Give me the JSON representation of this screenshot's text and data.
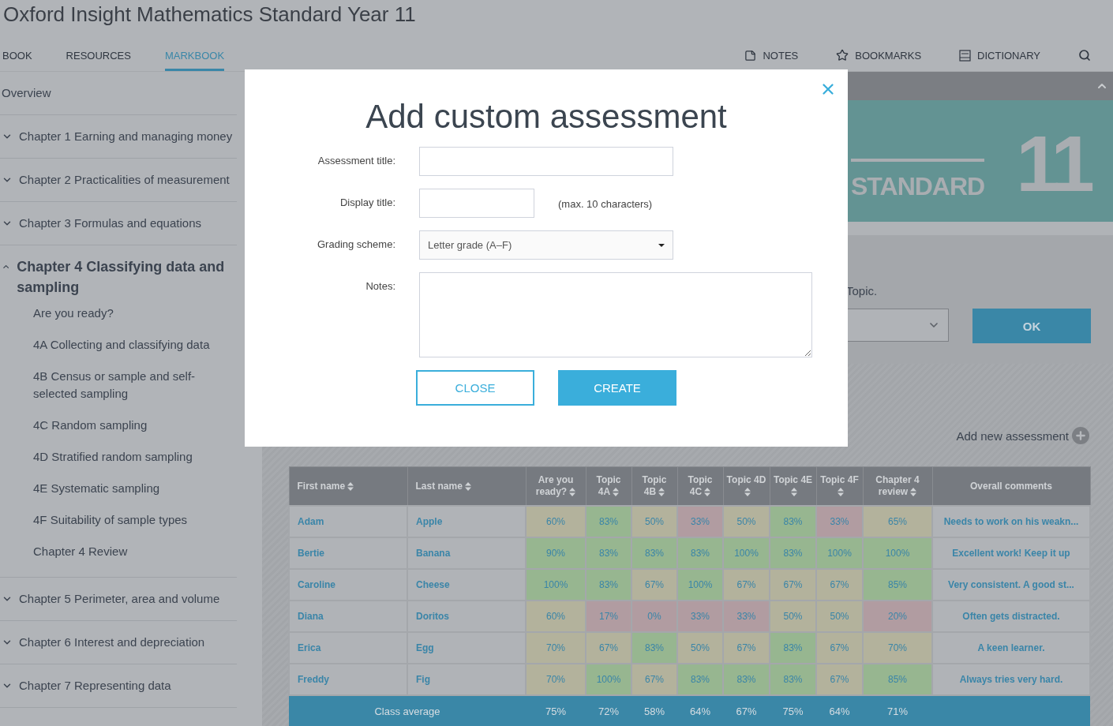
{
  "header": {
    "title": "Oxford Insight Mathematics Standard Year 11"
  },
  "nav": {
    "tabs": [
      {
        "label": "BOOK",
        "selected": false
      },
      {
        "label": "RESOURCES",
        "selected": false
      },
      {
        "label": "MARKBOOK",
        "selected": true
      }
    ],
    "tools": [
      {
        "kind": "notes",
        "label": "NOTES"
      },
      {
        "kind": "bookmarks",
        "label": "BOOKMARKS"
      },
      {
        "kind": "dictionary",
        "label": "DICTIONARY"
      },
      {
        "kind": "search"
      }
    ]
  },
  "sidebar": {
    "items": [
      {
        "kind": "plain",
        "label": "Overview"
      },
      {
        "kind": "chapter",
        "label": "Chapter 1 Earning and managing money",
        "expanded": false
      },
      {
        "kind": "chapter",
        "label": "Chapter 2 Practicalities of measurement",
        "expanded": false
      },
      {
        "kind": "chapter",
        "label": "Chapter 3 Formulas and equations",
        "expanded": false
      },
      {
        "kind": "chapter",
        "label": "Chapter 4 Classifying data and sampling",
        "expanded": true,
        "children": [
          {
            "label": "Are you ready?"
          },
          {
            "label": "4A Collecting and classifying data"
          },
          {
            "label": "4B Census or sample and self-selected sampling"
          },
          {
            "label": "4C Random sampling"
          },
          {
            "label": "4D Stratified random sampling"
          },
          {
            "label": "4E Systematic sampling"
          },
          {
            "label": "4F Suitability of sample types"
          },
          {
            "label": "Chapter 4 Review"
          }
        ]
      },
      {
        "kind": "chapter",
        "label": "Chapter 5 Perimeter, area and volume",
        "expanded": false
      },
      {
        "kind": "chapter",
        "label": "Chapter 6 Interest and depreciation",
        "expanded": false
      },
      {
        "kind": "chapter",
        "label": "Chapter 7 Representing data",
        "expanded": false
      }
    ]
  },
  "main": {
    "banner": {
      "word": "STANDARD",
      "number": "11"
    },
    "intro": {
      "text": "Topic."
    },
    "ok_button": "OK",
    "add_assessment": "Add new assessment",
    "table": {
      "columns": [
        {
          "label": "First name",
          "sortable": true
        },
        {
          "label": "Last name",
          "sortable": true
        },
        {
          "label": "Are you ready?",
          "sortable": true
        },
        {
          "label": "Topic 4A",
          "sortable": true
        },
        {
          "label": "Topic 4B",
          "sortable": true
        },
        {
          "label": "Topic 4C",
          "sortable": true
        },
        {
          "label": "Topic 4D",
          "sortable": true
        },
        {
          "label": "Topic 4E",
          "sortable": true
        },
        {
          "label": "Topic 4F",
          "sortable": true
        },
        {
          "label": "Chapter 4 review",
          "sortable": true
        },
        {
          "label": "Overall comments",
          "sortable": false
        }
      ],
      "rows": [
        {
          "first": "Adam",
          "last": "Apple",
          "scores": [
            {
              "value": "60%",
              "color": "#b3b29c"
            },
            {
              "value": "83%",
              "color": "#97b690"
            },
            {
              "value": "50%",
              "color": "#b3b29c"
            },
            {
              "value": "33%",
              "color": "#b19ca1"
            },
            {
              "value": "50%",
              "color": "#b3b29c"
            },
            {
              "value": "83%",
              "color": "#97b690"
            },
            {
              "value": "33%",
              "color": "#b19ca1"
            },
            {
              "value": "65%",
              "color": "#b3b29c"
            }
          ],
          "comment": "Needs to work on his weakn..."
        },
        {
          "first": "Bertie",
          "last": "Banana",
          "scores": [
            {
              "value": "90%",
              "color": "#97b690"
            },
            {
              "value": "83%",
              "color": "#97b690"
            },
            {
              "value": "83%",
              "color": "#97b690"
            },
            {
              "value": "83%",
              "color": "#97b690"
            },
            {
              "value": "100%",
              "color": "#97b690"
            },
            {
              "value": "83%",
              "color": "#97b690"
            },
            {
              "value": "100%",
              "color": "#97b690"
            },
            {
              "value": "100%",
              "color": "#97b690"
            }
          ],
          "comment": "Excellent work! Keep it up"
        },
        {
          "first": "Caroline",
          "last": "Cheese",
          "scores": [
            {
              "value": "100%",
              "color": "#97b690"
            },
            {
              "value": "83%",
              "color": "#97b690"
            },
            {
              "value": "67%",
              "color": "#b3b29c"
            },
            {
              "value": "100%",
              "color": "#97b690"
            },
            {
              "value": "67%",
              "color": "#b3b29c"
            },
            {
              "value": "67%",
              "color": "#b3b29c"
            },
            {
              "value": "67%",
              "color": "#b3b29c"
            },
            {
              "value": "85%",
              "color": "#97b690"
            }
          ],
          "comment": "Very consistent. A good st..."
        },
        {
          "first": "Diana",
          "last": "Doritos",
          "scores": [
            {
              "value": "60%",
              "color": "#b3b29c"
            },
            {
              "value": "17%",
              "color": "#b19ca1"
            },
            {
              "value": "0%",
              "color": "#b19ca1"
            },
            {
              "value": "33%",
              "color": "#b19ca1"
            },
            {
              "value": "33%",
              "color": "#b19ca1"
            },
            {
              "value": "50%",
              "color": "#b3b29c"
            },
            {
              "value": "50%",
              "color": "#b3b29c"
            },
            {
              "value": "20%",
              "color": "#b19ca1"
            }
          ],
          "comment": "Often gets distracted."
        },
        {
          "first": "Erica",
          "last": "Egg",
          "scores": [
            {
              "value": "70%",
              "color": "#b3b29c"
            },
            {
              "value": "67%",
              "color": "#b3b29c"
            },
            {
              "value": "83%",
              "color": "#97b690"
            },
            {
              "value": "50%",
              "color": "#b3b29c"
            },
            {
              "value": "67%",
              "color": "#b3b29c"
            },
            {
              "value": "83%",
              "color": "#97b690"
            },
            {
              "value": "67%",
              "color": "#b3b29c"
            },
            {
              "value": "70%",
              "color": "#b3b29c"
            }
          ],
          "comment": "A keen learner."
        },
        {
          "first": "Freddy",
          "last": "Fig",
          "scores": [
            {
              "value": "70%",
              "color": "#b3b29c"
            },
            {
              "value": "100%",
              "color": "#97b690"
            },
            {
              "value": "67%",
              "color": "#b3b29c"
            },
            {
              "value": "83%",
              "color": "#97b690"
            },
            {
              "value": "83%",
              "color": "#97b690"
            },
            {
              "value": "83%",
              "color": "#97b690"
            },
            {
              "value": "67%",
              "color": "#b3b29c"
            },
            {
              "value": "85%",
              "color": "#97b690"
            }
          ],
          "comment": "Always tries very hard."
        }
      ],
      "average": {
        "label": "Class average",
        "values": [
          "75%",
          "72%",
          "58%",
          "64%",
          "67%",
          "75%",
          "64%",
          "71%"
        ]
      }
    }
  },
  "modal": {
    "title": "Add custom assessment",
    "fields": [
      {
        "kind": "text",
        "label": "Assessment title:"
      },
      {
        "kind": "text",
        "label": "Display title:",
        "note": "(max. 10 characters)"
      },
      {
        "kind": "select",
        "label": "Grading scheme:",
        "value": "Letter grade (A–F)"
      },
      {
        "kind": "textarea",
        "label": "Notes:"
      }
    ],
    "buttons": [
      {
        "kind": "secondary",
        "label": "CLOSE"
      },
      {
        "kind": "primary",
        "label": "CREATE"
      }
    ]
  }
}
